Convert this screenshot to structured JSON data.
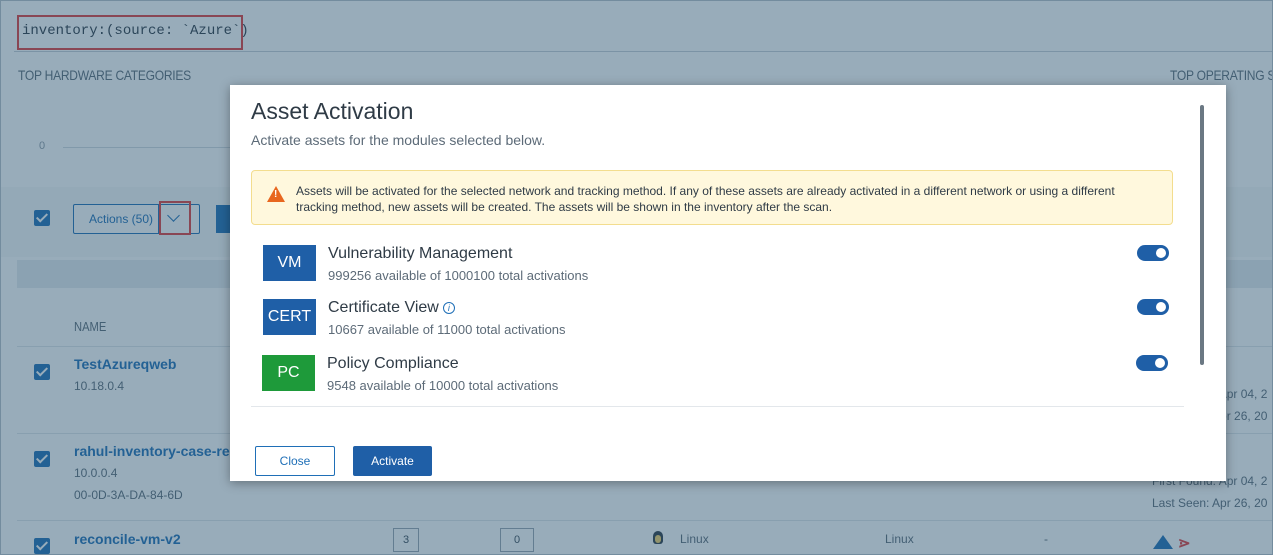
{
  "search": {
    "query": "inventory:(source: `Azure`)"
  },
  "dashboard": {
    "hardware_title": "TOP HARDWARE CATEGORIES",
    "os_title": "TOP OPERATING SY",
    "chart_zero": "0"
  },
  "toolbar": {
    "actions_label": "Actions (50)"
  },
  "table": {
    "col_name": "NAME",
    "rows": [
      {
        "name": "TestAzureqweb",
        "ip": "10.18.0.4",
        "first_found": "First Found: Apr 04, 2",
        "last_seen": "Last Seen: Apr 26, 20"
      },
      {
        "name": "rahul-inventory-case-re",
        "ip": "10.0.0.4",
        "mac": "00-0D-3A-DA-84-6D",
        "first_found": "First Found: Apr 04, 2",
        "last_seen": "Last Seen: Apr 26, 20"
      },
      {
        "name": "reconcile-vm-v2",
        "count_a": "3",
        "count_b": "0",
        "os": "Linux",
        "os_family": "Linux",
        "dash": "-"
      }
    ]
  },
  "modal": {
    "title": "Asset Activation",
    "subtitle": "Activate assets for the modules selected below.",
    "warning": "Assets will be activated for the selected network and tracking method. If any of these assets are already activated in a different network or using a different tracking method, new assets will be created. The assets will be shown in the inventory after the scan.",
    "modules": [
      {
        "code": "VM",
        "name": "Vulnerability Management",
        "availability": "999256 available of 1000100 total activations",
        "enabled": true,
        "color": "#1f5fa7"
      },
      {
        "code": "CERT",
        "name": "Certificate View",
        "availability": "10667 available of 11000 total activations",
        "enabled": true,
        "color": "#1f5fa7",
        "info_icon": "info-icon"
      },
      {
        "code": "PC",
        "name": "Policy Compliance",
        "availability": "9548 available of 10000 total activations",
        "enabled": true,
        "color": "#1e9a3a"
      }
    ],
    "close_label": "Close",
    "activate_label": "Activate"
  }
}
